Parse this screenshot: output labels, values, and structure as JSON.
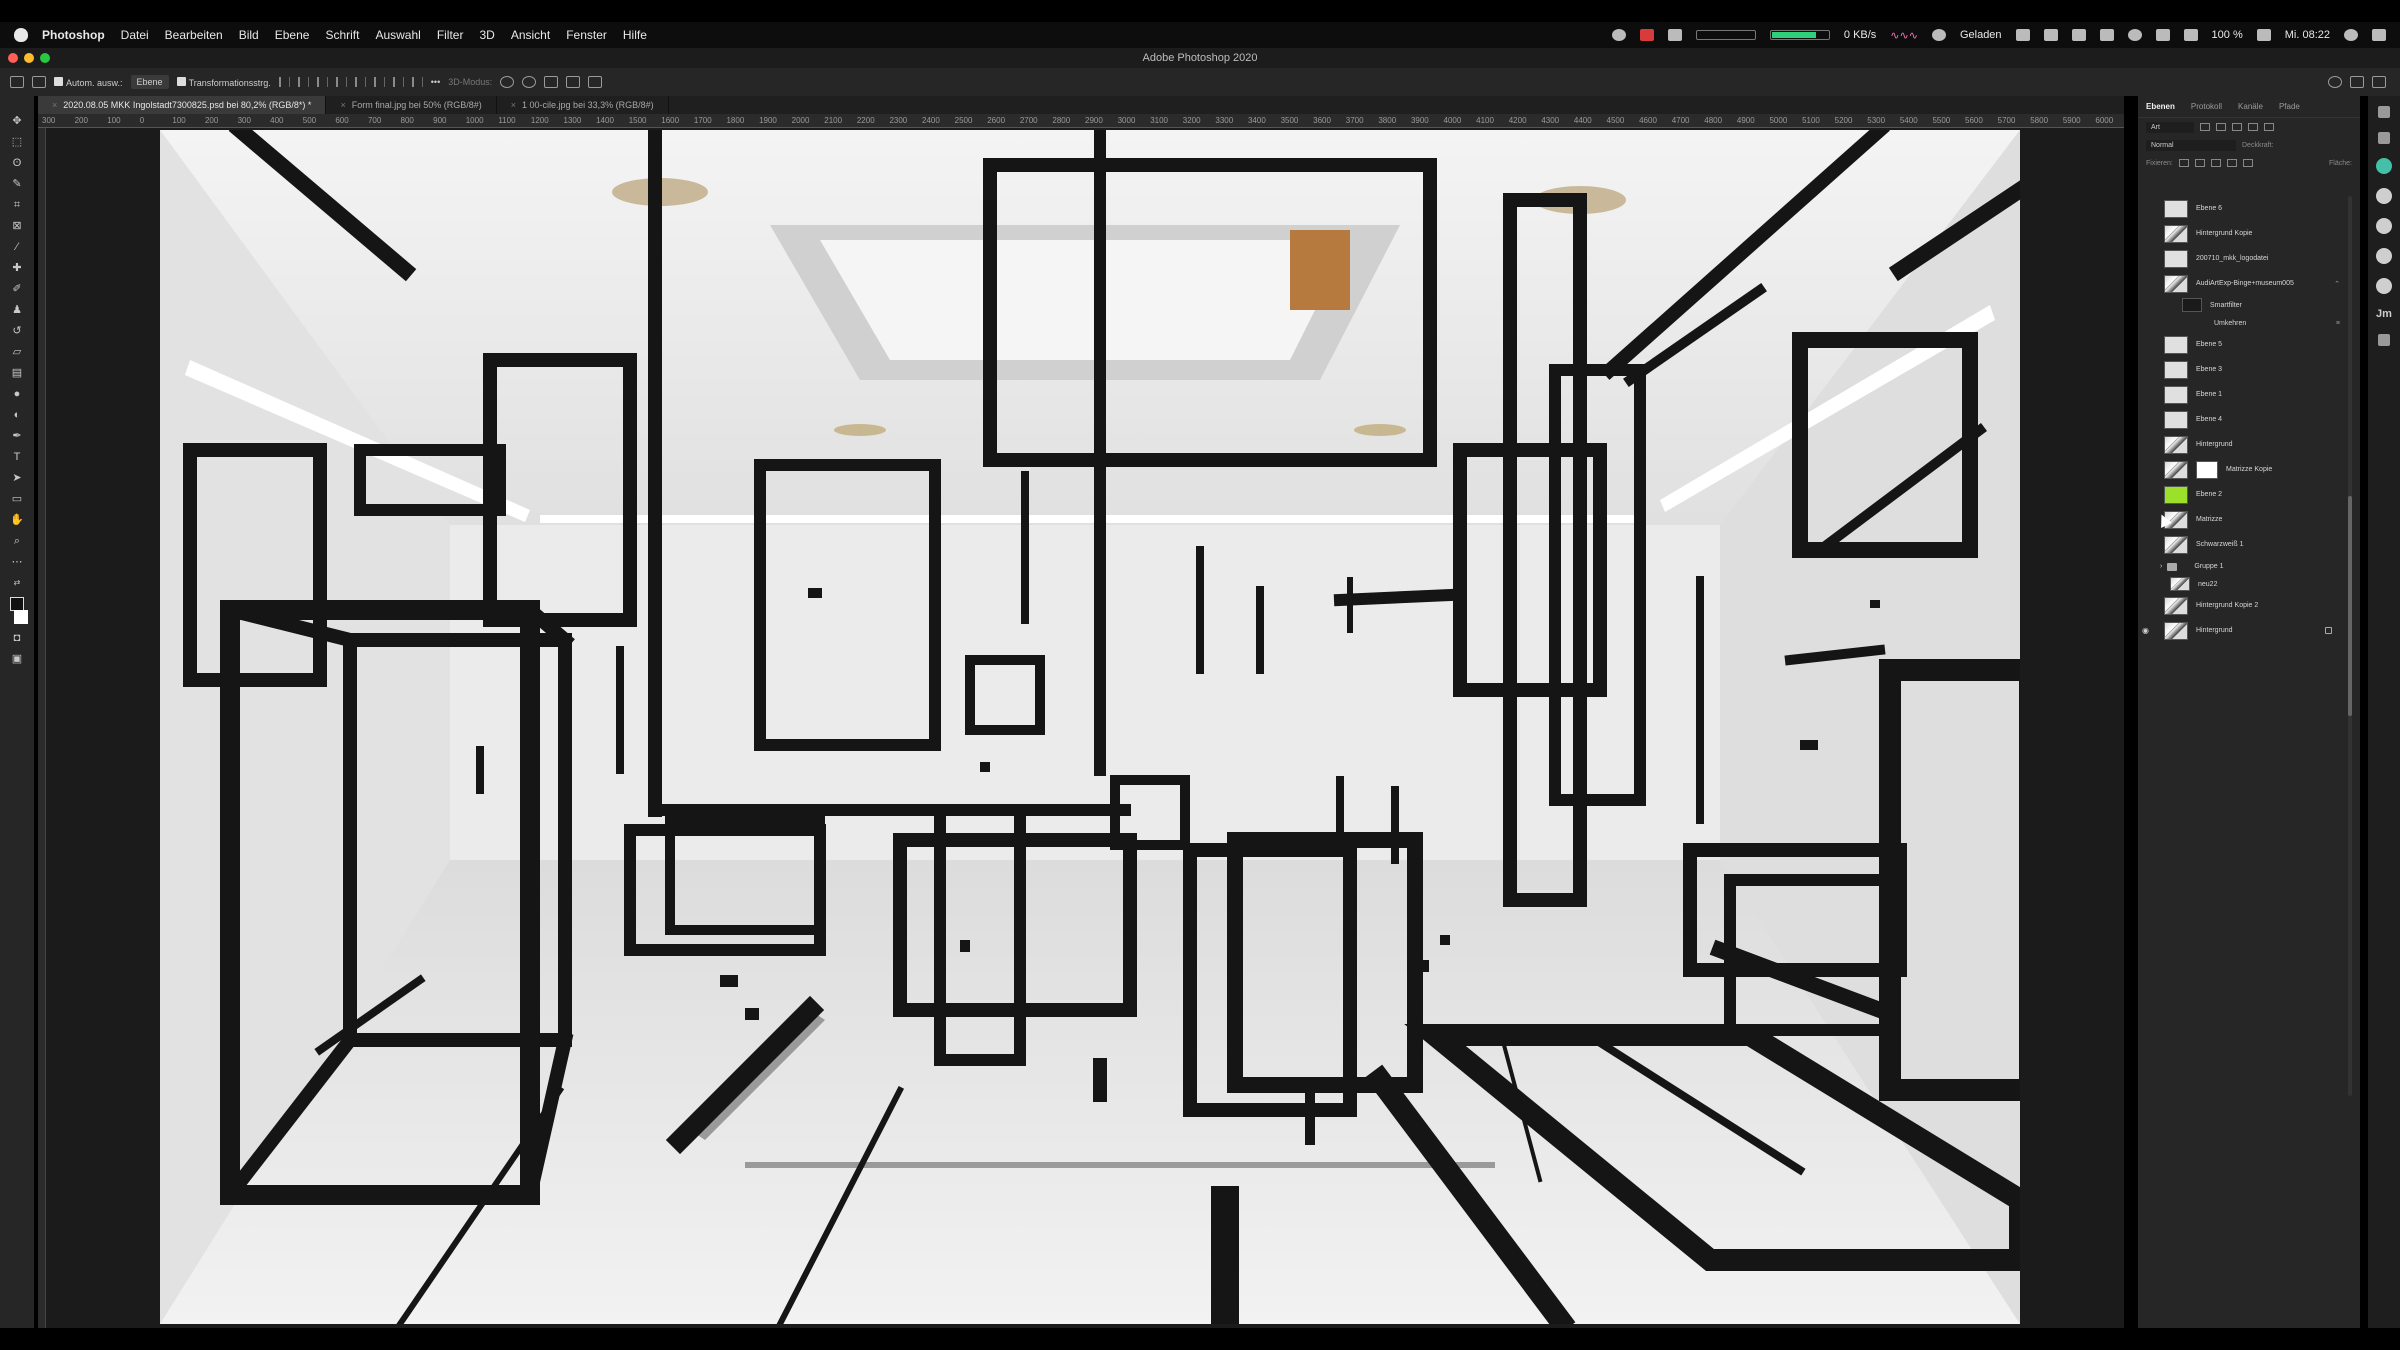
{
  "menubar": {
    "items": [
      "Photoshop",
      "Datei",
      "Bearbeiten",
      "Bild",
      "Ebene",
      "Schrift",
      "Auswahl",
      "Filter",
      "3D",
      "Ansicht",
      "Fenster",
      "Hilfe"
    ],
    "status": {
      "net_label": "0 KB/s",
      "charging": "Geladen",
      "battery": "100 %",
      "clock": "Mi. 08:22"
    }
  },
  "window": {
    "title": "Adobe Photoshop 2020"
  },
  "options_bar": {
    "auto_select_label": "Autom. ausw.:",
    "auto_select_value": "Ebene",
    "transform_label": "Transformationsstrg.",
    "mode_3d": "3D-Modus:"
  },
  "tabs": [
    {
      "label": "2020.08.05 MKK Ingolstadt7300825.psd bei 80,2% (RGB/8*) *",
      "active": true
    },
    {
      "label": "Form final.jpg bei 50% (RGB/8#)",
      "active": false
    },
    {
      "label": "1 00-cile.jpg bei 33,3% (RGB/8#)",
      "active": false
    }
  ],
  "ruler_ticks": [
    "300",
    "200",
    "100",
    "0",
    "100",
    "200",
    "300",
    "400",
    "500",
    "600",
    "700",
    "800",
    "900",
    "1000",
    "1100",
    "1200",
    "1300",
    "1400",
    "1500",
    "1600",
    "1700",
    "1800",
    "1900",
    "2000",
    "2100",
    "2200",
    "2300",
    "2400",
    "2500",
    "2600",
    "2700",
    "2800",
    "2900",
    "3000",
    "3100",
    "3200",
    "3300",
    "3400",
    "3500",
    "3600",
    "3700",
    "3800",
    "3900",
    "4000",
    "4100",
    "4200",
    "4300",
    "4400",
    "4500",
    "4600",
    "4700",
    "4800",
    "4900",
    "5000",
    "5100",
    "5200",
    "5300",
    "5400",
    "5500",
    "5600",
    "5700",
    "5800",
    "5900",
    "6000"
  ],
  "tools": [
    "move",
    "marquee",
    "lasso",
    "quick-select",
    "crop",
    "frame",
    "eyedropper",
    "healing",
    "brush",
    "stamp",
    "history-brush",
    "eraser",
    "gradient",
    "blur",
    "dodge",
    "pen",
    "type",
    "path-select",
    "rectangle",
    "hand",
    "zoom",
    "more"
  ],
  "panels": {
    "tabs": [
      "Ebenen",
      "Protokoll",
      "Kanäle",
      "Pfade"
    ],
    "filter_label": "Art",
    "blend_mode": "Normal",
    "opacity_label": "Deckkraft:",
    "lock_label": "Fixieren:",
    "fill_label": "Fläche:",
    "layers": [
      {
        "name": "Ebene 6",
        "thumb": "white",
        "visible": false
      },
      {
        "name": "Hintergrund Kopie",
        "thumb": "photo",
        "visible": false
      },
      {
        "name": "200710_mkk_logodatei",
        "thumb": "white",
        "visible": false
      },
      {
        "name": "AudiArtExp-Binge+museum005",
        "thumb": "photo",
        "visible": false,
        "smart": true
      },
      {
        "name": "Smartfilter",
        "thumb": "dark",
        "visible": false,
        "sub": true
      },
      {
        "name": "Umkehren",
        "thumb": "none",
        "visible": false,
        "sub": true
      },
      {
        "name": "Ebene 5",
        "thumb": "white",
        "visible": false
      },
      {
        "name": "Ebene 3",
        "thumb": "white",
        "visible": false
      },
      {
        "name": "Ebene 1",
        "thumb": "white",
        "visible": false
      },
      {
        "name": "Ebene 4",
        "thumb": "white",
        "visible": false
      },
      {
        "name": "Hintergrund",
        "thumb": "photo",
        "visible": false
      },
      {
        "name": "Matrizze Kopie",
        "thumb": "photo",
        "visible": false,
        "mask": true
      },
      {
        "name": "Ebene 2",
        "thumb": "lime",
        "visible": false
      },
      {
        "name": "Matrizze",
        "thumb": "photo",
        "visible": false
      },
      {
        "name": "Schwarzweiß 1",
        "thumb": "photo",
        "visible": false
      },
      {
        "name": "Gruppe 1",
        "thumb": "folder",
        "visible": false
      },
      {
        "name": "neu22",
        "thumb": "photo",
        "visible": false
      },
      {
        "name": "Hintergrund Kopie 2",
        "thumb": "photo",
        "visible": false
      },
      {
        "name": "Hintergrund",
        "thumb": "photo",
        "visible": true,
        "locked": true
      }
    ]
  },
  "iconstrip": [
    "character-icon",
    "paragraph-icon",
    "globe-icon",
    "globe-icon-2",
    "globe-icon-3",
    "globe-icon-4",
    "globe-icon-5",
    "jm-text",
    "tools-icon"
  ],
  "strip_text": "Jm"
}
